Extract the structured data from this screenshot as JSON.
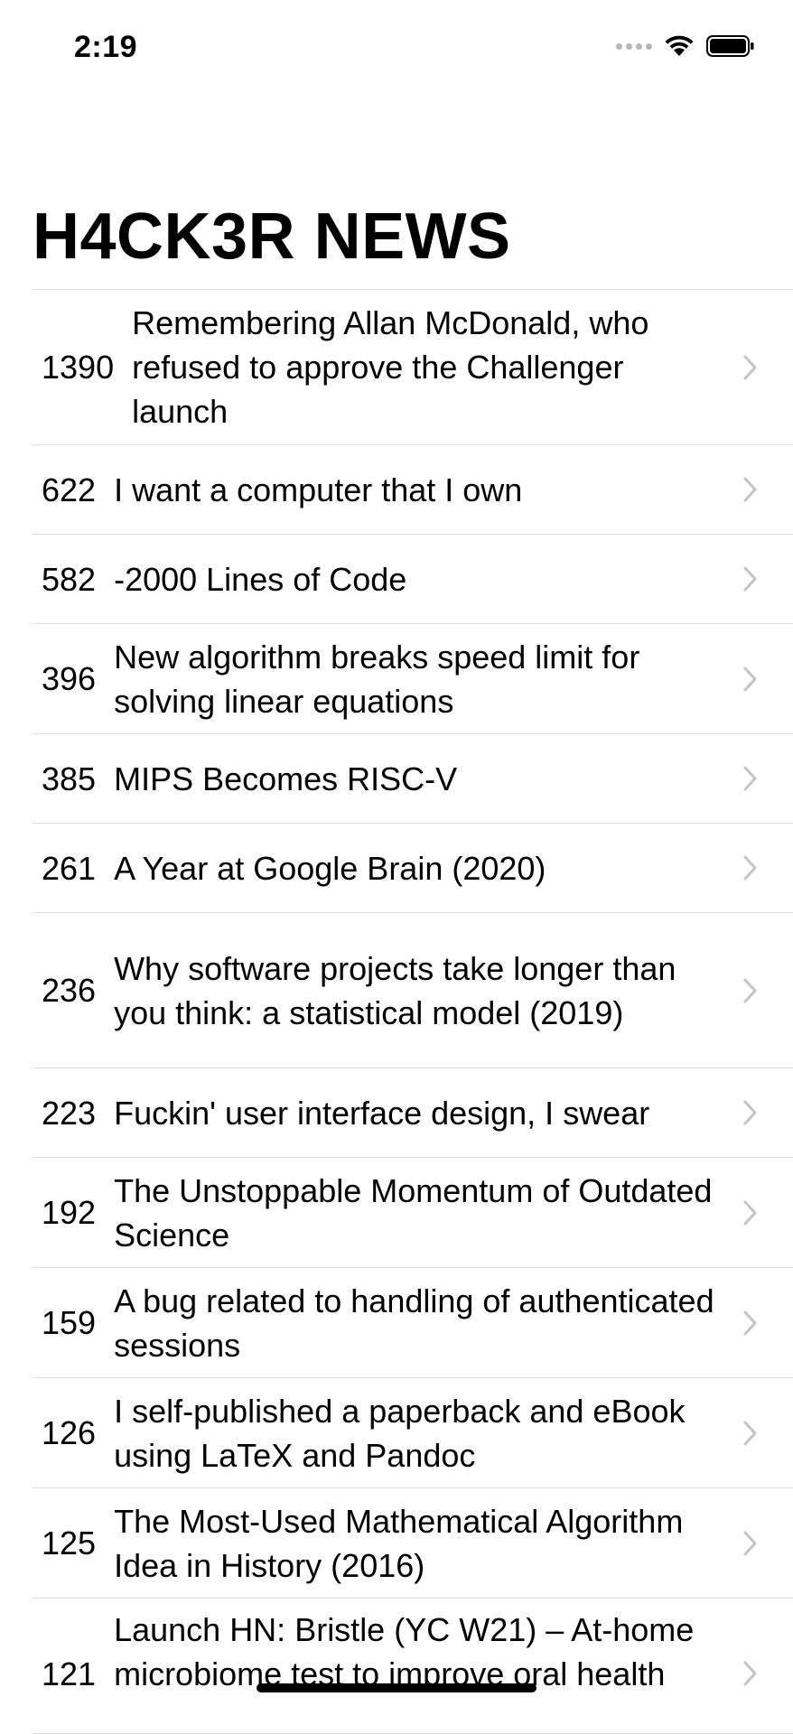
{
  "status_bar": {
    "time": "2:19",
    "icons": [
      "cellular-signal-icon",
      "wifi-icon",
      "battery-icon"
    ]
  },
  "page": {
    "title": "H4CK3R NEWS"
  },
  "stories": [
    {
      "score": "1390",
      "title": "Remembering Allan McDonald, who refused to approve the Challenger launch"
    },
    {
      "score": "622",
      "title": "I want a computer that I own"
    },
    {
      "score": "582",
      "title": "-2000 Lines of Code"
    },
    {
      "score": "396",
      "title": "New algorithm breaks speed limit for solving linear equations"
    },
    {
      "score": "385",
      "title": "MIPS Becomes RISC-V"
    },
    {
      "score": "261",
      "title": "A Year at Google Brain (2020)"
    },
    {
      "score": "236",
      "title": "Why software projects take longer than you think: a statistical model (2019)"
    },
    {
      "score": "223",
      "title": "Fuckin' user interface design, I swear"
    },
    {
      "score": "192",
      "title": "The Unstoppable Momentum of Outdated Science"
    },
    {
      "score": "159",
      "title": "A bug related to handling of authenticated sessions"
    },
    {
      "score": "126",
      "title": "I self-published a paperback and eBook using LaTeX and Pandoc"
    },
    {
      "score": "125",
      "title": "The Most-Used Mathematical Algorithm Idea in History (2016)"
    },
    {
      "score": "121",
      "title": "Launch HN: Bristle (YC W21) – At-home microbiome test to improve oral health"
    }
  ],
  "colors": {
    "separator": "#dedede",
    "chevron": "#c4c4c8",
    "text": "#000000"
  }
}
